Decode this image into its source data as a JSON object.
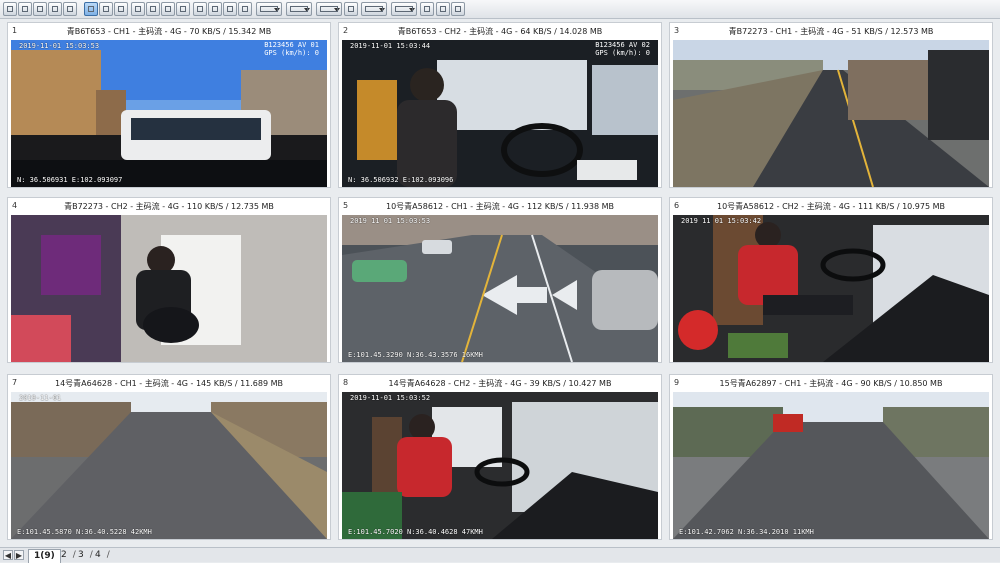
{
  "toolbar": {
    "buttons": [
      "layout-1-icon",
      "layout-4-icon",
      "layout-6-icon",
      "layout-8-icon",
      "layout-9-icon",
      "layout-10-icon",
      "layout-13-icon",
      "layout-16-icon",
      "layout-25-icon",
      "layout-36-icon",
      "layout-64-icon",
      "layout-100-icon",
      "zoom-in-icon",
      "zoom-out-icon",
      "capture-icon",
      "rotate-icon",
      "window-icon",
      "display-mode-icon",
      "snapshot-icon",
      "audio-icon",
      "play-icon",
      "stop-icon",
      "fullscreen-icon",
      "exit-icon"
    ],
    "active": "layout-9-icon"
  },
  "tiles": [
    {
      "num": "1",
      "title": "青B6T653 - CH1 - 主码流 - 4G - 70 KB/S / 15.342 MB",
      "osd_time": "2019-11-01 15:03:53",
      "osd_right": "B123456 AV 01\nGPS (km/h): 0",
      "osd_bottom": "N: 36.506931 E:102.093097"
    },
    {
      "num": "2",
      "title": "青B6T653 - CH2 - 主码流 - 4G - 64 KB/S / 14.028 MB",
      "osd_time": "2019-11-01 15:03:44",
      "osd_right": "B123456 AV 02\nGPS (km/h): 0",
      "osd_bottom": "N: 36.506932 E:102.093096"
    },
    {
      "num": "3",
      "title": "青B72273 - CH1 - 主码流 - 4G - 51 KB/S / 12.573 MB",
      "osd_time": "",
      "osd_right": "",
      "osd_bottom": ""
    },
    {
      "num": "4",
      "title": "青B72273 - CH2 - 主码流 - 4G - 110 KB/S / 12.735 MB",
      "osd_time": "",
      "osd_right": "",
      "osd_bottom": ""
    },
    {
      "num": "5",
      "title": "10号青A58612 - CH1 - 主码流 - 4G - 112 KB/S / 11.938 MB",
      "osd_time": "2019 11 01 15:03:53",
      "osd_right": "",
      "osd_bottom": "E:101.45.3290 N:36.43.3576 16KMH"
    },
    {
      "num": "6",
      "title": "10号青A58612 - CH2 - 主码流 - 4G - 111 KB/S / 10.975 MB",
      "osd_time": "2019 11 01 15:03:42",
      "osd_right": "",
      "osd_bottom": ""
    },
    {
      "num": "7",
      "title": "14号青A64628 - CH1 - 主码流 - 4G - 145 KB/S / 11.689 MB",
      "osd_time": "2019-11-01",
      "osd_right": "",
      "osd_bottom": "E:101.45.5870 N:36.40.5228 42KMH"
    },
    {
      "num": "8",
      "title": "14号青A64628 - CH2 - 主码流 - 4G - 39 KB/S / 10.427 MB",
      "osd_time": "2019-11-01 15:03:52",
      "osd_right": "",
      "osd_bottom": "E:101.45.7020 N:36.40.4628 47KMH"
    },
    {
      "num": "9",
      "title": "15号青A62897 - CH1 - 主码流 - 4G - 90 KB/S / 10.850 MB",
      "osd_time": "",
      "osd_right": "",
      "osd_bottom": "E:101.42.7062 N:36.34.2010 11KMH"
    }
  ],
  "pages": {
    "tabs": [
      "1(9)",
      "2",
      "3",
      "4"
    ],
    "active": "1(9)"
  },
  "colors": {
    "toolbar_active": "#7fb1e6",
    "tile_border": "#c7ccd2",
    "background": "#e9ecef"
  }
}
